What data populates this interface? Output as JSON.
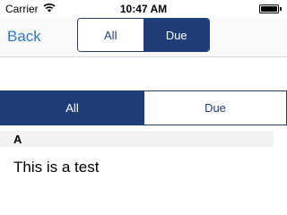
{
  "status_bar": {
    "carrier": "Carrier",
    "time": "10:47 AM",
    "wifi_icon": "wifi-icon",
    "battery_icon": "battery-icon",
    "battery_level": 1.0
  },
  "nav_bar": {
    "back_label": "Back",
    "segments": [
      {
        "label": "All",
        "selected": false
      },
      {
        "label": "Due",
        "selected": true
      }
    ]
  },
  "filter_control": {
    "segments": [
      {
        "label": "All",
        "selected": true
      },
      {
        "label": "Due",
        "selected": false
      }
    ]
  },
  "list": {
    "sections": [
      {
        "title": "A",
        "rows": [
          {
            "text": "This is a test"
          }
        ]
      }
    ]
  },
  "colors": {
    "accent": "#1f3e79",
    "back_link": "#2e7abf",
    "section_header_bg": "#f2f2f2"
  }
}
